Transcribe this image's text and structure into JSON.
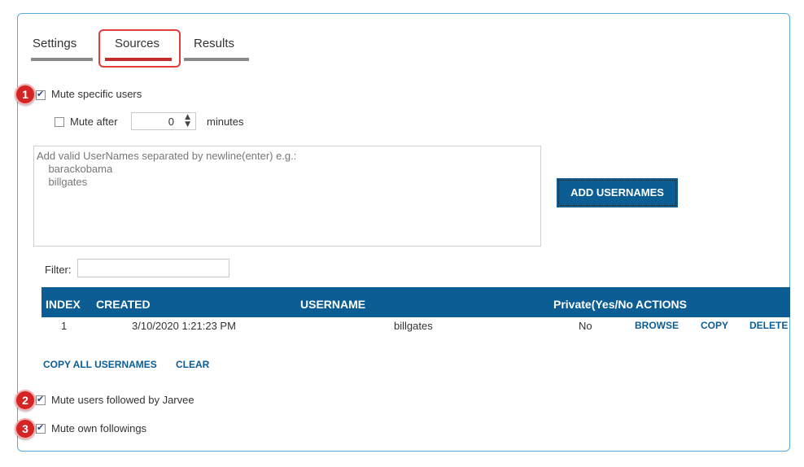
{
  "tabs": [
    {
      "label": "Settings"
    },
    {
      "label": "Sources"
    },
    {
      "label": "Results"
    }
  ],
  "badges": [
    "1",
    "2",
    "3"
  ],
  "mute_specific": {
    "label": "Mute specific users",
    "checked": true
  },
  "mute_after": {
    "label": "Mute after",
    "value": "0",
    "unit": "minutes",
    "checked": false
  },
  "usernames_textarea": {
    "placeholder": "Add valid UserNames separated by newline(enter) e.g.:\n    barackobama\n    billgates"
  },
  "add_button": {
    "label": "ADD USERNAMES"
  },
  "filter": {
    "label": "Filter:",
    "value": ""
  },
  "table": {
    "headers": {
      "index": "INDEX",
      "created": "CREATED",
      "username": "USERNAME",
      "private": "Private(Yes/No)",
      "actions": "ACTIONS"
    },
    "rows": [
      {
        "index": "1",
        "created": "3/10/2020 1:21:23 PM",
        "username": "billgates",
        "private": "No",
        "browse": "BROWSE",
        "copy": "COPY",
        "delete": "DELETE"
      }
    ]
  },
  "bulk": {
    "copy_all": "COPY ALL USERNAMES",
    "clear": "CLEAR"
  },
  "mute_followed_by": {
    "label": "Mute users followed by Jarvee",
    "checked": true
  },
  "mute_own_followings": {
    "label": "Mute own followings",
    "checked": true
  },
  "colors": {
    "accent": "#0b5d94",
    "highlight": "#e23c3c",
    "badge": "#d42424"
  }
}
